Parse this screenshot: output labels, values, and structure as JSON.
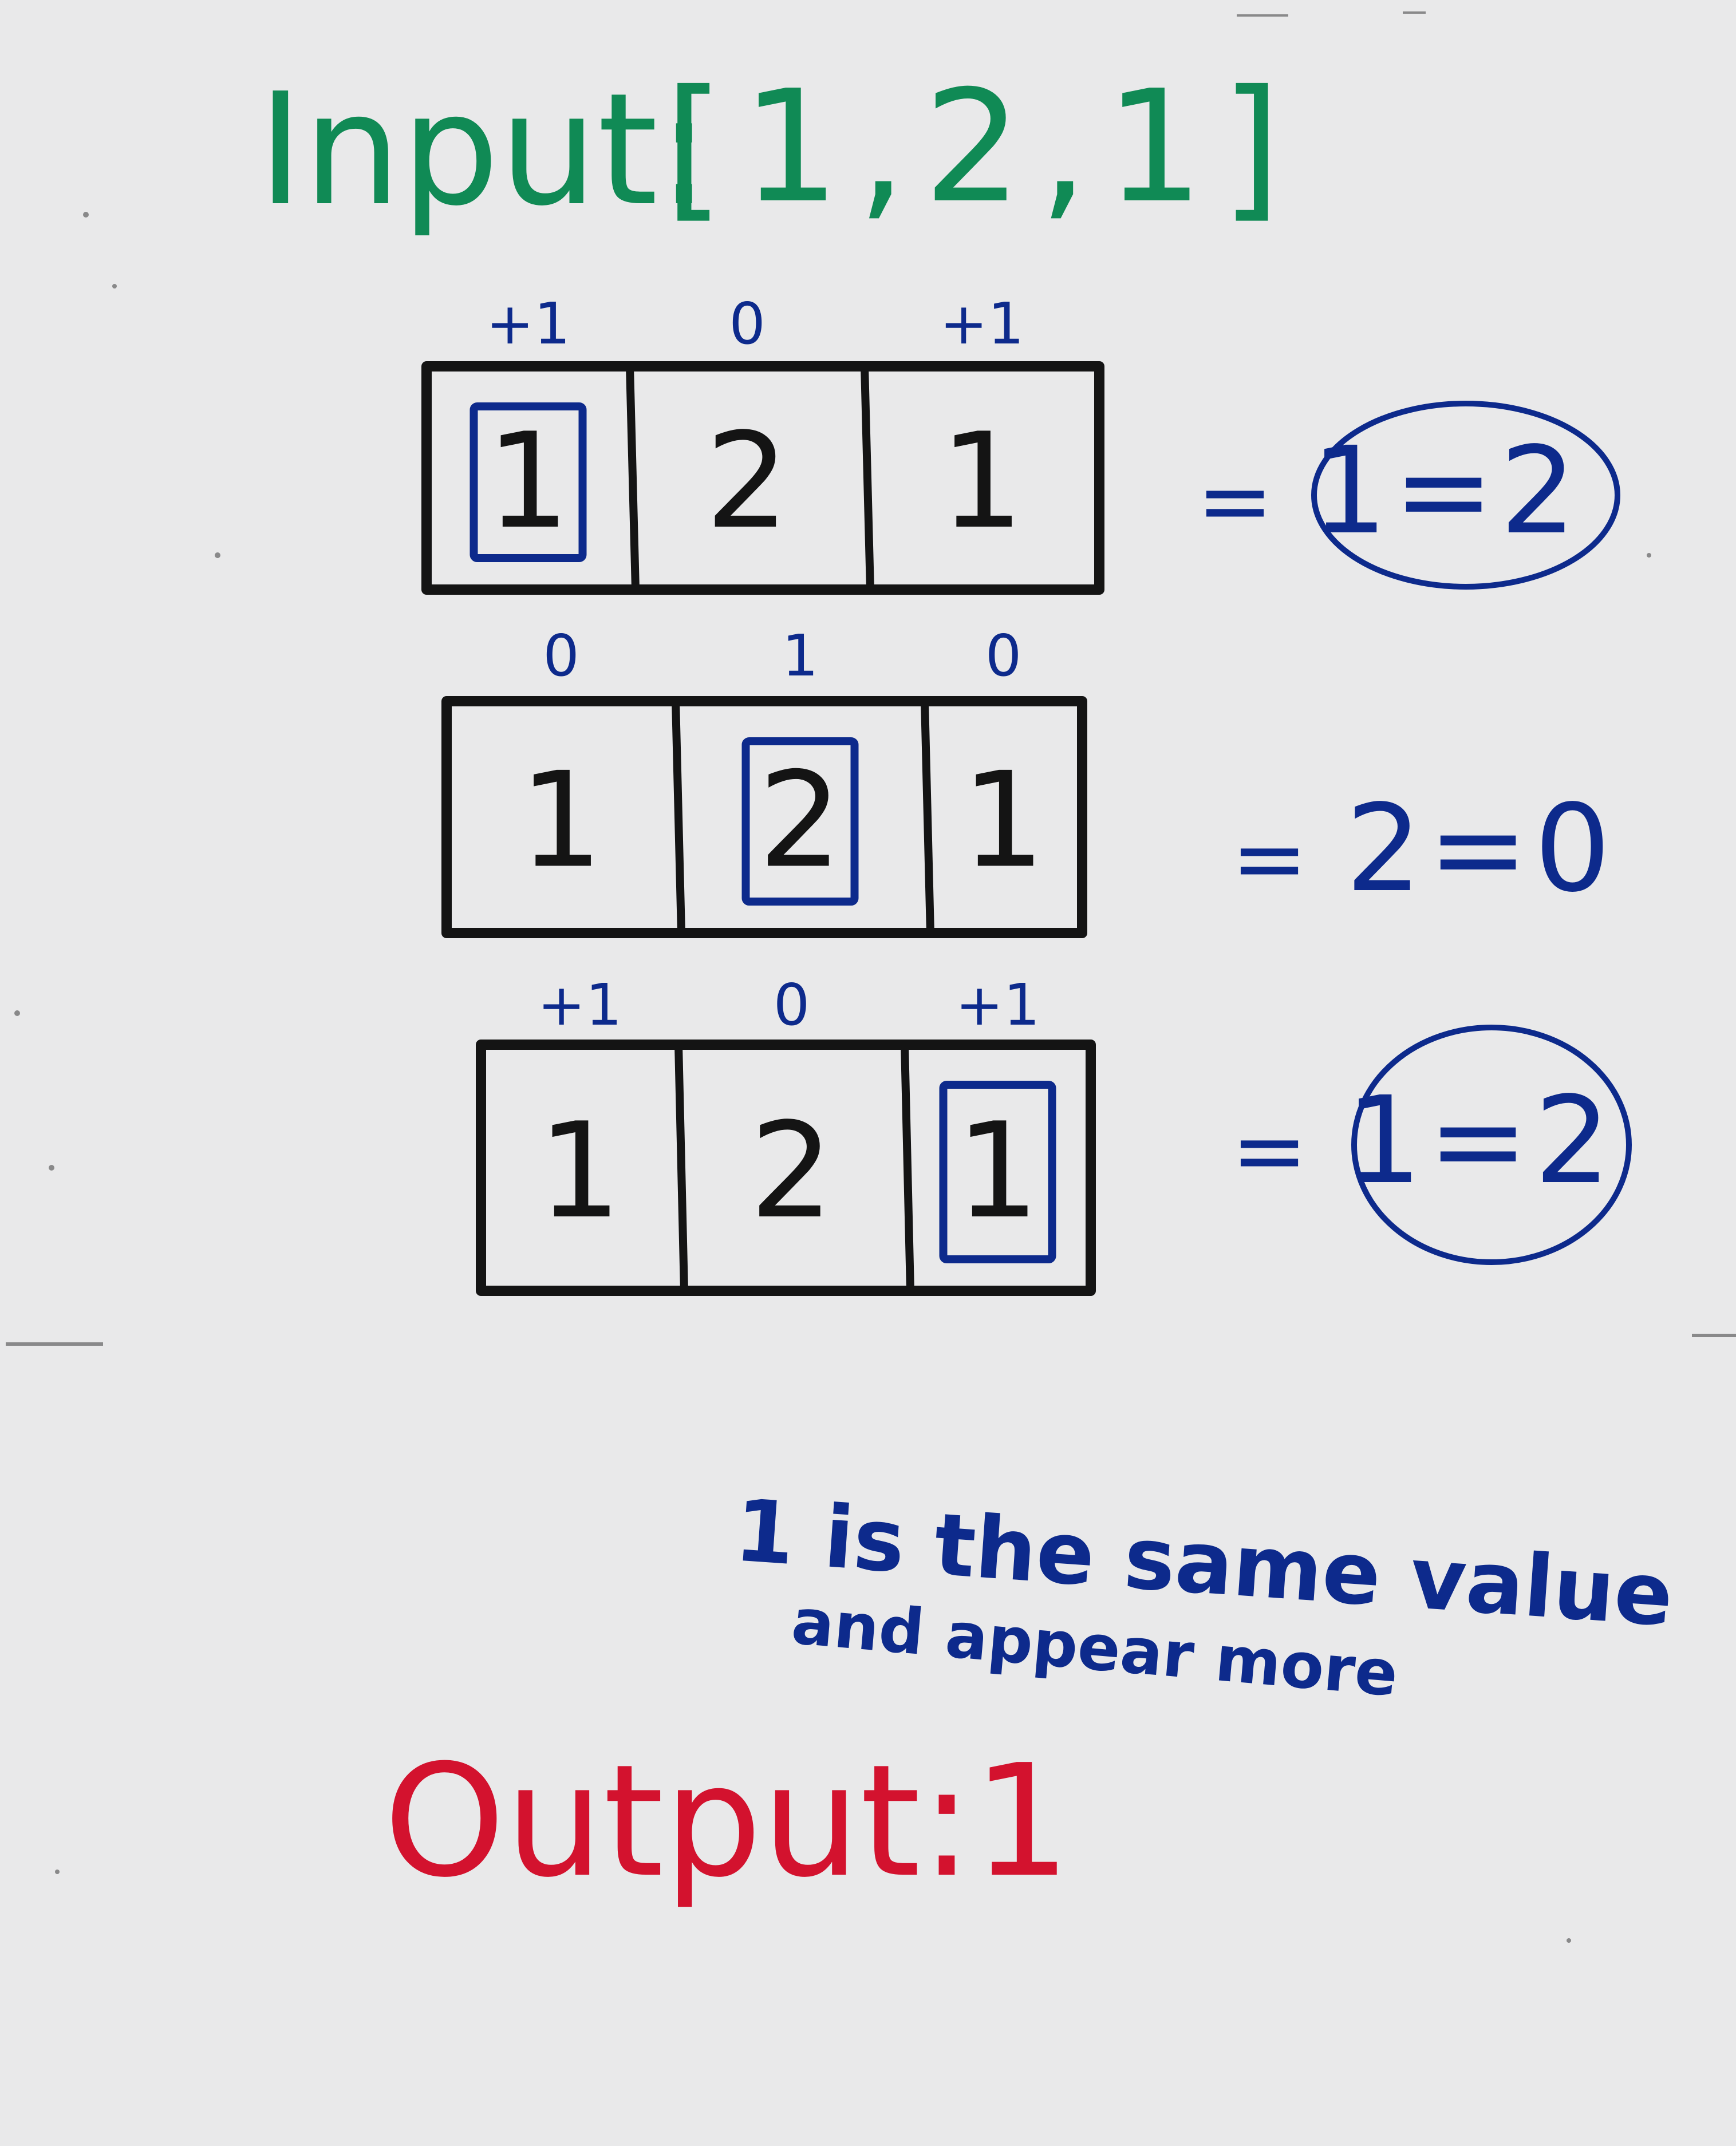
{
  "input": {
    "label": "Input:",
    "array_text": "[1,2,1]"
  },
  "colors": {
    "board": "#e9e9ea",
    "input_ink": "#108a55",
    "annotation_ink": "#0d2a8c",
    "cell_ink": "#141414",
    "output_ink": "#d3122e"
  },
  "rows": [
    {
      "weights": [
        "+1",
        "0",
        "+1"
      ],
      "cells": [
        "1",
        "2",
        "1"
      ],
      "highlighted_index": 0,
      "result_eq": "=",
      "result": "1=2",
      "result_circled": true
    },
    {
      "weights": [
        "0",
        "1",
        "0"
      ],
      "cells": [
        "1",
        "2",
        "1"
      ],
      "highlighted_index": 1,
      "result_eq": "=",
      "result": "2=0",
      "result_circled": false
    },
    {
      "weights": [
        "+1",
        "0",
        "+1"
      ],
      "cells": [
        "1",
        "2",
        "1"
      ],
      "highlighted_index": 2,
      "result_eq": "=",
      "result": "1=2",
      "result_circled": true
    }
  ],
  "note": {
    "line1": "1 is the same value",
    "line2": "and appear more"
  },
  "output": {
    "text": "Output:1"
  }
}
